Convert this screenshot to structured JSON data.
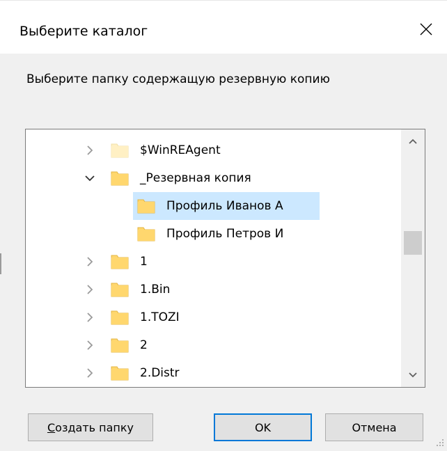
{
  "dialog": {
    "title": "Выберите каталог",
    "prompt": "Выберите папку содержащую резервную копию"
  },
  "tree": {
    "items": [
      {
        "label": "$WinREAgent",
        "expander": "collapsed",
        "level": 0,
        "selected": false,
        "folder_style": "faded"
      },
      {
        "label": "_Резервная копия",
        "expander": "expanded",
        "level": 0,
        "selected": false,
        "folder_style": "normal"
      },
      {
        "label": "Профиль Иванов А",
        "expander": "none",
        "level": 1,
        "selected": true,
        "folder_style": "normal"
      },
      {
        "label": "Профиль Петров И",
        "expander": "none",
        "level": 1,
        "selected": false,
        "folder_style": "normal"
      },
      {
        "label": "1",
        "expander": "collapsed",
        "level": 0,
        "selected": false,
        "folder_style": "normal"
      },
      {
        "label": "1.Bin",
        "expander": "collapsed",
        "level": 0,
        "selected": false,
        "folder_style": "normal"
      },
      {
        "label": "1.TOZI",
        "expander": "collapsed",
        "level": 0,
        "selected": false,
        "folder_style": "normal"
      },
      {
        "label": "2",
        "expander": "collapsed",
        "level": 0,
        "selected": false,
        "folder_style": "normal"
      },
      {
        "label": "2.Distr",
        "expander": "collapsed",
        "level": 0,
        "selected": false,
        "folder_style": "normal"
      }
    ]
  },
  "buttons": {
    "create_folder_mnemonic": "С",
    "create_folder_rest": "оздать папку",
    "ok": "OK",
    "cancel": "Отмена"
  },
  "colors": {
    "selection": "#cce8ff",
    "default_button_border": "#0078d7",
    "folder_fill": "#ffd76e",
    "folder_faded": "#fff0c4"
  },
  "icons": {
    "close": "close-icon",
    "scroll_up": "chevron-up-icon",
    "scroll_down": "chevron-down-icon",
    "expander_collapsed": "chevron-right-icon",
    "expander_expanded": "chevron-down-icon",
    "folder": "folder-icon"
  }
}
